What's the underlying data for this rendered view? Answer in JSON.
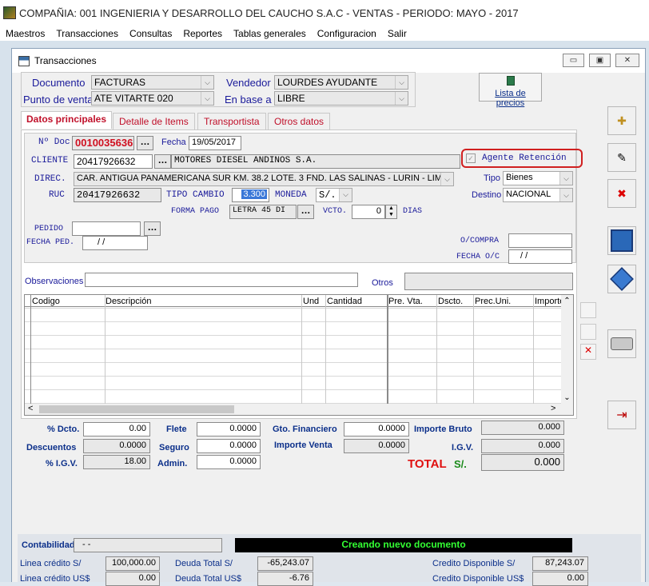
{
  "app": {
    "title": "COMPAÑIA: 001 INGENIERIA Y DESARROLLO DEL CAUCHO S.A.C  -  VENTAS  -  PERIODO: MAYO - 2017",
    "menu": [
      "Maestros",
      "Transacciones",
      "Consultas",
      "Reportes",
      "Tablas generales",
      "Configuracion",
      "Salir"
    ]
  },
  "window": {
    "title": "Transacciones",
    "min": "▭",
    "max": "▣",
    "close": "✕"
  },
  "header": {
    "documento_label": "Documento",
    "documento_value": "FACTURAS",
    "punto_label": "Punto de venta",
    "punto_value": "ATE VITARTE 020",
    "vendedor_label": "Vendedor",
    "vendedor_value": "LOURDES AYUDANTE",
    "enbase_label": "En base a",
    "enbase_value": "LIBRE",
    "lista_precios": "Lista de precios"
  },
  "tabs": [
    "Datos principales",
    "Detalle de Items",
    "Transportista",
    "Otros datos"
  ],
  "main": {
    "ndoc_label": "Nº Doc.",
    "ndoc_value": "0010035636",
    "fecha_label": "Fecha",
    "fecha_value": "19/05/2017",
    "cliente_label": "CLIENTE",
    "cliente_ruc": "20417926632",
    "cliente_nombre": "MOTORES DIESEL ANDINOS S.A.",
    "agente_label": "Agente Retención",
    "agente_check": "✓",
    "direc_label": "DIREC.",
    "direc_value": "CAR. ANTIGUA PANAMERICANA SUR KM. 38.2 LOTE. 3 FND. LAS SALINAS - LURIN - LIMA",
    "tipo_label": "Tipo",
    "tipo_value": "Bienes",
    "ruc_label": "RUC",
    "ruc_value": "20417926632",
    "tipocambio_label": "TIPO CAMBIO",
    "tipocambio_value": "3.300",
    "moneda_label": "MONEDA",
    "moneda_value": "S/.",
    "destino_label": "Destino",
    "destino_value": "NACIONAL",
    "formapago_label": "FORMA PAGO",
    "formapago_value": "LETRA 45 DI",
    "vcto_label": "VCTO.",
    "vcto_value": "0",
    "dias_label": "DIAS",
    "pedido_label": "PEDIDO",
    "fechaped_label": "FECHA PED.",
    "fechaped_value": "/   /",
    "ocompra_label": "O/COMPRA",
    "fechaoc_label": "FECHA O/C",
    "fechaoc_value": "/   /",
    "observaciones_label": "Observaciones",
    "otros_label": "Otros"
  },
  "grid": {
    "columns": [
      "Codigo",
      "Descripción",
      "Und",
      "Cantidad",
      "Pre. Vta.",
      "Dscto.",
      "Prec.Uni.",
      "Importe"
    ]
  },
  "totals": {
    "dcto_label": "% Dcto.",
    "dcto_value": "0.00",
    "descuentos_label": "Descuentos",
    "descuentos_value": "0.0000",
    "igv_pct_label": "% I.G.V.",
    "igv_pct_value": "18.00",
    "flete_label": "Flete",
    "flete_value": "0.0000",
    "seguro_label": "Seguro",
    "seguro_value": "0.0000",
    "admin_label": "Admin.",
    "admin_value": "0.0000",
    "gtofin_label": "Gto. Financiero",
    "gtofin_value": "0.0000",
    "impventa_label": "Importe Venta",
    "impventa_value": "0.0000",
    "impbruto_label": "Importe Bruto",
    "impbruto_value": "0.000",
    "igv_label": "I.G.V.",
    "igv_value": "0.000",
    "total_label": "TOTAL",
    "total_currency": "S/.",
    "total_value": "0.000"
  },
  "footer": {
    "contabilidad_label": "Contabilidad",
    "contabilidad_value": "-  -",
    "status": "Creando nuevo documento",
    "linea_sol_label": "Linea crédito S/",
    "linea_sol_value": "100,000.00",
    "deuda_sol_label": "Deuda Total  S/",
    "deuda_sol_value": "-65,243.07",
    "credito_sol_label": "Credito Disponible  S/",
    "credito_sol_value": "87,243.07",
    "linea_usd_label": "Linea crédito US$",
    "linea_usd_value": "0.00",
    "deuda_usd_label": "Deuda Total US$",
    "deuda_usd_value": "-6.76",
    "credito_usd_label": "Credito Disponible  US$",
    "credito_usd_value": "0.00"
  },
  "colors": {
    "accent_red": "#c0102a",
    "status_bg": "#000000",
    "status_fg": "#33ff33",
    "highlight": "#d02020"
  }
}
